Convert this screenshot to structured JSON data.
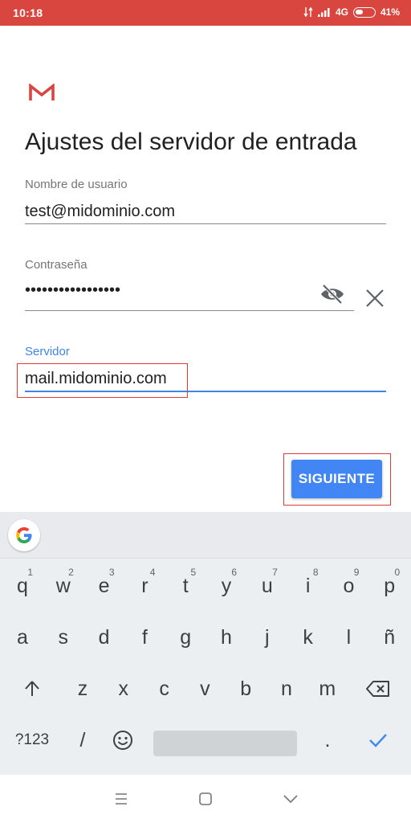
{
  "status_bar": {
    "time": "10:18",
    "network": "4G",
    "battery_percent": "41%",
    "battery_level": 0.41,
    "icons": [
      "data-transfer-icon",
      "signal-icon",
      "battery-icon"
    ],
    "color": "#d9463f"
  },
  "app": {
    "logo": "gmail-logo",
    "title": "Ajustes del servidor de entrada"
  },
  "form": {
    "username": {
      "label": "Nombre de usuario",
      "value": "test@midominio.com"
    },
    "password": {
      "label": "Contraseña",
      "value": "•••••••••••••••••",
      "toggle_icon": "eye-off-icon",
      "clear_icon": "close-icon"
    },
    "server": {
      "label": "Servidor",
      "value": "mail.midominio.com",
      "focused": true
    }
  },
  "next_button": {
    "label": "SIGUIENTE",
    "color": "#4285f4"
  },
  "annotation_color": "#e53935",
  "keyboard": {
    "toolbar_icon": "google-g-icon",
    "row1": [
      {
        "k": "q",
        "h": "1"
      },
      {
        "k": "w",
        "h": "2"
      },
      {
        "k": "e",
        "h": "3"
      },
      {
        "k": "r",
        "h": "4"
      },
      {
        "k": "t",
        "h": "5"
      },
      {
        "k": "y",
        "h": "6"
      },
      {
        "k": "u",
        "h": "7"
      },
      {
        "k": "i",
        "h": "8"
      },
      {
        "k": "o",
        "h": "9"
      },
      {
        "k": "p",
        "h": "0"
      }
    ],
    "row2": [
      "a",
      "s",
      "d",
      "f",
      "g",
      "h",
      "j",
      "k",
      "l",
      "ñ"
    ],
    "row3": [
      "z",
      "x",
      "c",
      "v",
      "b",
      "n",
      "m"
    ],
    "symbols_label": "?123",
    "slash": "/",
    "period": ".",
    "shift_icon": "shift-arrow-icon",
    "backspace_icon": "backspace-icon",
    "emoji_icon": "emoji-icon",
    "enter_icon": "checkmark-icon"
  },
  "nav_bar": {
    "icons": [
      "menu-icon",
      "home-square-icon",
      "back-chevron-icon"
    ]
  }
}
